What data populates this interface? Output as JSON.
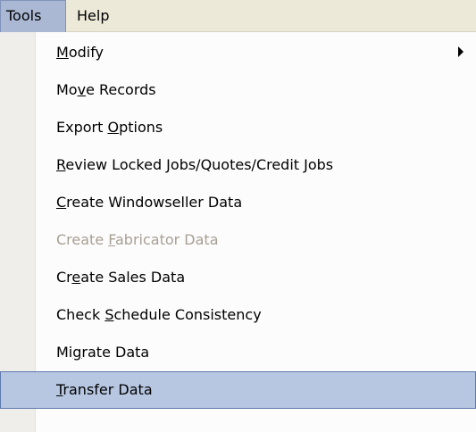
{
  "menubar": {
    "tools": "Tools",
    "help": "Help"
  },
  "menu": {
    "items": [
      {
        "pre": "",
        "key": "M",
        "post": "odify",
        "disabled": false,
        "submenu": true
      },
      {
        "pre": "Mo",
        "key": "v",
        "post": "e Records",
        "disabled": false
      },
      {
        "pre": "Export ",
        "key": "O",
        "post": "ptions",
        "disabled": false
      },
      {
        "pre": "",
        "key": "R",
        "post": "eview Locked Jobs/Quotes/Credit Jobs",
        "disabled": false
      },
      {
        "pre": "",
        "key": "C",
        "post": "reate Windowseller Data",
        "disabled": false
      },
      {
        "pre": "Create ",
        "key": "F",
        "post": "abricator Data",
        "disabled": true
      },
      {
        "pre": "Cr",
        "key": "e",
        "post": "ate Sales Data",
        "disabled": false
      },
      {
        "pre": "Check ",
        "key": "S",
        "post": "chedule Consistency",
        "disabled": false
      },
      {
        "pre": "Mi",
        "key": "g",
        "post": "rate Data",
        "disabled": false
      },
      {
        "pre": "",
        "key": "T",
        "post": "ransfer Data",
        "disabled": false,
        "highlighted": true
      }
    ]
  }
}
